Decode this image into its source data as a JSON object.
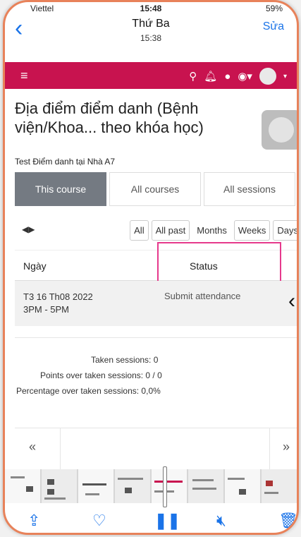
{
  "status_bar": {
    "carrier": "Viettel",
    "time": "15:48",
    "battery": "59%"
  },
  "nav": {
    "back_icon": "chevron-left",
    "title": "Thứ Ba",
    "subtitle": "15:38",
    "edit_label": "Sửa"
  },
  "appbar": {
    "color": "#c8134f",
    "icons": [
      "menu-icon",
      "search-icon",
      "bell-icon",
      "chat-icon",
      "globe-icon",
      "avatar"
    ]
  },
  "page": {
    "title": "Địa điểm điểm danh (Bệnh viện/Khoa... theo khóa học)",
    "subtitle": "Test Điểm danh tại Nhà A7"
  },
  "tabs": [
    {
      "label": "This course",
      "active": true
    },
    {
      "label": "All courses",
      "active": false
    },
    {
      "label": "All sessions",
      "active": false
    }
  ],
  "filters": {
    "arrows": "◀▶",
    "buttons": [
      "All",
      "All past",
      "Months",
      "Weeks",
      "Days"
    ],
    "selected": "Months"
  },
  "table": {
    "headers": {
      "date": "Ngày",
      "status": "Status"
    },
    "rows": [
      {
        "date": "T3 16 Th08 2022",
        "time": "3PM - 5PM",
        "status": "Submit attendance"
      }
    ]
  },
  "stats": {
    "taken": "Taken sessions: 0",
    "points": "Points over taken sessions: 0 / 0",
    "percentage": "Percentage over taken sessions: 0,0%"
  },
  "pager": {
    "prev": "«",
    "next": "»"
  },
  "highlight_color": "#e6398c",
  "toolbar": {
    "icons": [
      "share-icon",
      "heart-icon",
      "pause-icon",
      "mute-icon",
      "trash-icon"
    ]
  }
}
